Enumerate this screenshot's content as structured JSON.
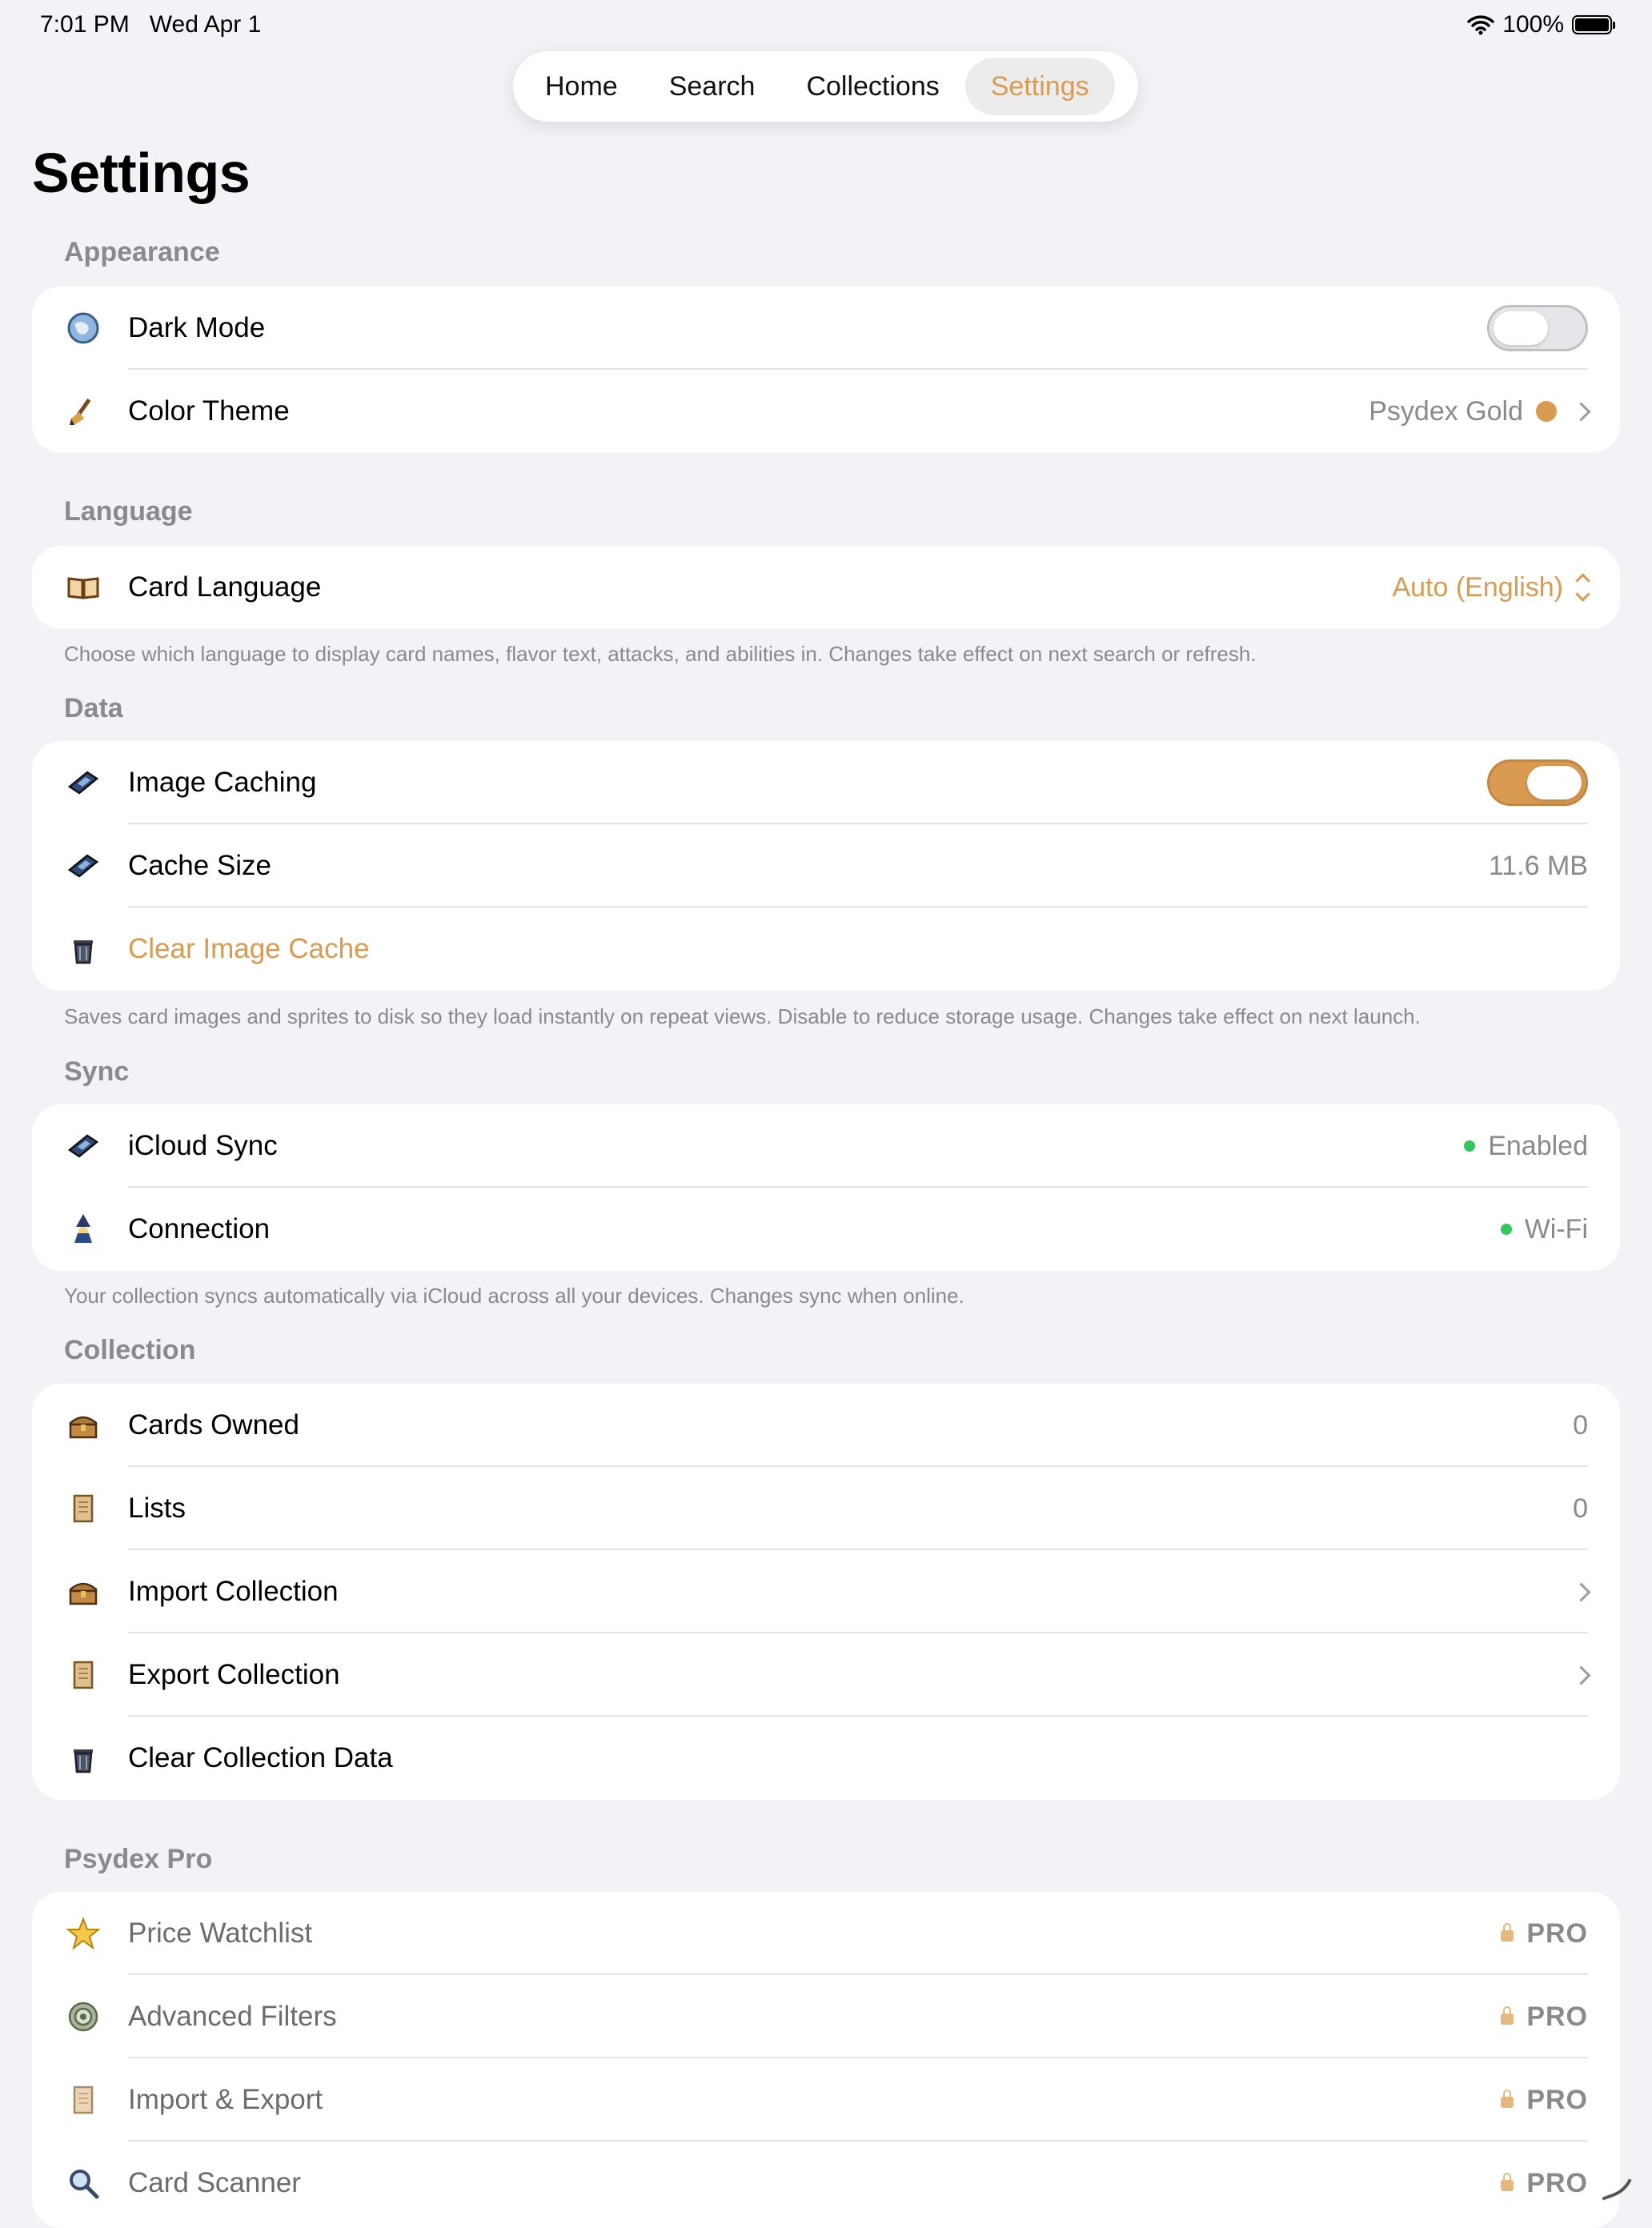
{
  "status_bar": {
    "time": "7:01 PM",
    "date": "Wed Apr 1",
    "battery": "100%"
  },
  "tabs": [
    {
      "label": "Home"
    },
    {
      "label": "Search"
    },
    {
      "label": "Collections"
    },
    {
      "label": "Settings",
      "active": true
    }
  ],
  "page_title": "Settings",
  "accent_color": "#d99a52",
  "sections": {
    "appearance": {
      "header": "Appearance",
      "dark_mode": {
        "label": "Dark Mode",
        "icon": "globe-icon",
        "enabled": false
      },
      "color_theme": {
        "label": "Color Theme",
        "icon": "broom-icon",
        "value": "Psydex Gold"
      }
    },
    "language": {
      "header": "Language",
      "card_language": {
        "label": "Card Language",
        "icon": "book-icon",
        "value": "Auto (English)"
      },
      "note": "Choose which language to display card names, flavor text, attacks, and abilities in. Changes take effect on next search or refresh."
    },
    "data": {
      "header": "Data",
      "image_caching": {
        "label": "Image Caching",
        "icon": "disk-icon",
        "enabled": true
      },
      "cache_size": {
        "label": "Cache Size",
        "icon": "disk-icon",
        "value": "11.6 MB"
      },
      "clear_cache": {
        "label": "Clear Image Cache",
        "icon": "trash-icon"
      },
      "note": "Saves card images and sprites to disk so they load instantly on repeat views. Disable to reduce storage usage. Changes take effect on next launch."
    },
    "sync": {
      "header": "Sync",
      "icloud": {
        "label": "iCloud Sync",
        "icon": "disk-icon",
        "value": "Enabled"
      },
      "connection": {
        "label": "Connection",
        "icon": "wizard-icon",
        "value": "Wi-Fi"
      },
      "note": "Your collection syncs automatically via iCloud across all your devices. Changes sync when online."
    },
    "collection": {
      "header": "Collection",
      "cards_owned": {
        "label": "Cards Owned",
        "icon": "chest-icon",
        "value": "0"
      },
      "lists": {
        "label": "Lists",
        "icon": "scroll-icon",
        "value": "0"
      },
      "import": {
        "label": "Import Collection",
        "icon": "chest-icon"
      },
      "export": {
        "label": "Export Collection",
        "icon": "scroll-icon"
      },
      "clear": {
        "label": "Clear Collection Data",
        "icon": "trash-icon"
      }
    },
    "pro": {
      "header": "Psydex Pro",
      "badge": "PRO",
      "items": [
        {
          "label": "Price Watchlist",
          "icon": "star-icon"
        },
        {
          "label": "Advanced Filters",
          "icon": "target-icon"
        },
        {
          "label": "Import & Export",
          "icon": "scroll-icon"
        },
        {
          "label": "Card Scanner",
          "icon": "magnifier-icon"
        }
      ]
    }
  }
}
